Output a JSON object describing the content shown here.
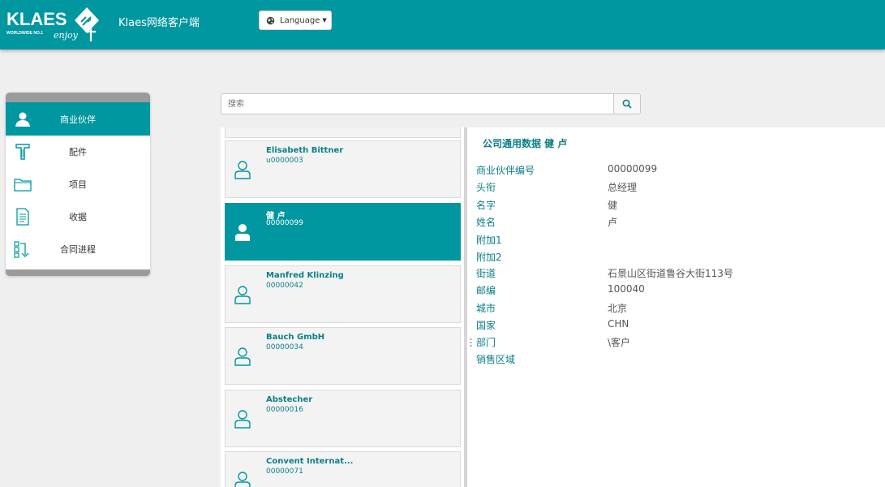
{
  "header": {
    "logo_text": "KLAES",
    "logo_tagline": "WORLDWIDE NO.1",
    "logo_script": "enjoy",
    "app_title": "Klaes网络客户端",
    "language_label": "Language",
    "brand_color": "#0097a0"
  },
  "sidebar": {
    "items": [
      {
        "label": "商业伙伴",
        "icon": "person-icon",
        "active": true
      },
      {
        "label": "配件",
        "icon": "profile-t-icon",
        "active": false
      },
      {
        "label": "项目",
        "icon": "folder-icon",
        "active": false
      },
      {
        "label": "收据",
        "icon": "document-icon",
        "active": false
      },
      {
        "label": "合同进程",
        "icon": "workflow-icon",
        "active": false
      }
    ]
  },
  "search": {
    "placeholder": "搜索"
  },
  "partners": [
    {
      "name": "Elisabeth Bittner",
      "id": "u0000003",
      "selected": false
    },
    {
      "name": "健 卢",
      "id": "00000099",
      "selected": true
    },
    {
      "name": "Manfred Klinzing",
      "id": "00000042",
      "selected": false
    },
    {
      "name": "Bauch GmbH",
      "id": "00000034",
      "selected": false
    },
    {
      "name": "Abstecher",
      "id": "00000016",
      "selected": false
    },
    {
      "name": "Convent Internat...",
      "id": "00000071",
      "selected": false
    }
  ],
  "detail": {
    "title": "公司通用数据 健 卢",
    "fields": [
      {
        "label": "商业伙伴编号",
        "value": "00000099"
      },
      {
        "label": "头衔",
        "value": "总经理"
      },
      {
        "label": "名字",
        "value": "健"
      },
      {
        "label": "姓名",
        "value": "卢"
      },
      {
        "label": "附加1",
        "value": ""
      },
      {
        "label": "附加2",
        "value": ""
      },
      {
        "label": "街道",
        "value": "石景山区街道鲁谷大街113号"
      },
      {
        "label": "邮编",
        "value": "100040"
      },
      {
        "label": "城市",
        "value": "北京"
      },
      {
        "label": "国家",
        "value": "CHN"
      },
      {
        "label": "部门",
        "value": "\\客户"
      },
      {
        "label": "销售区域",
        "value": ""
      }
    ]
  }
}
